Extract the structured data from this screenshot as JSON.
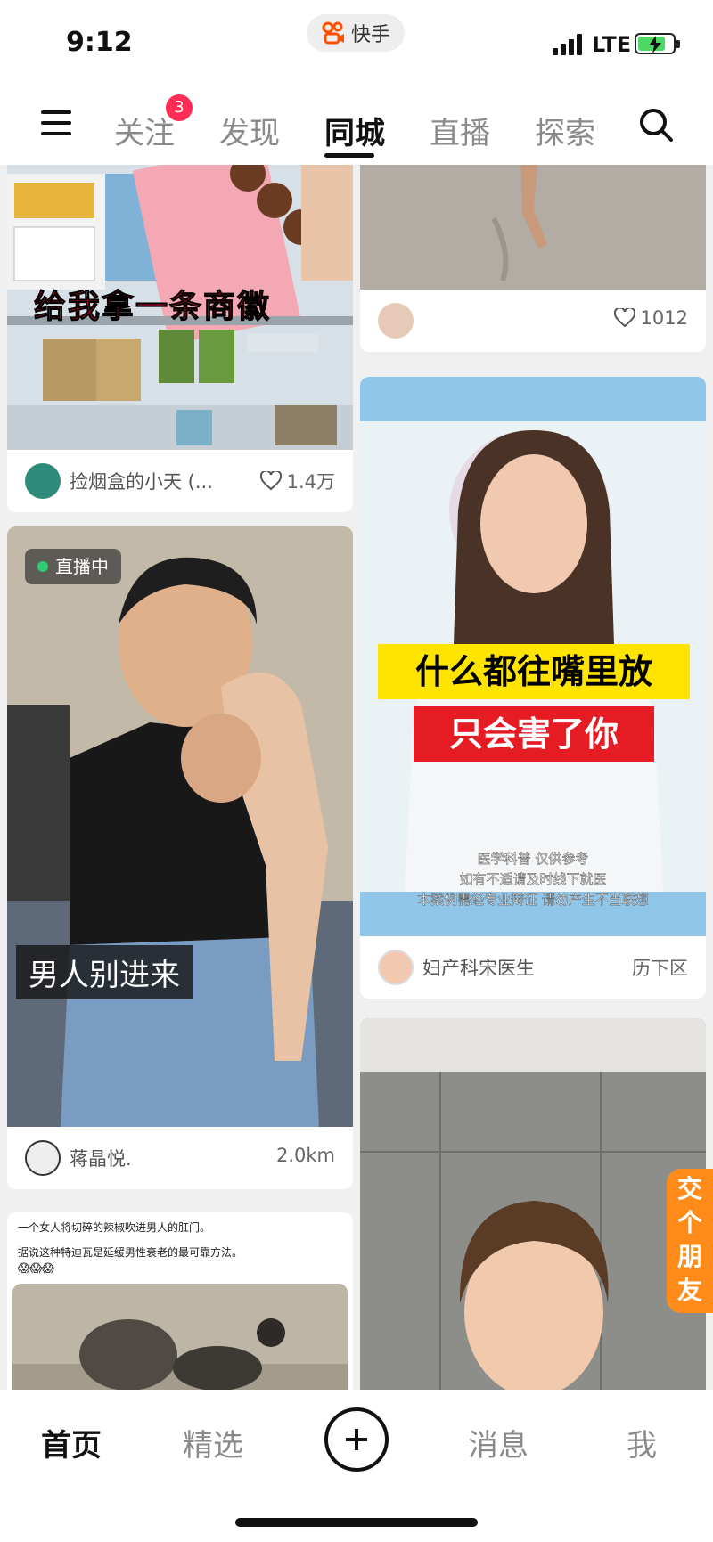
{
  "status_bar": {
    "time": "9:12",
    "app_name": "快手",
    "network": "LTE"
  },
  "top_nav": {
    "tabs": [
      {
        "label": "关注",
        "badge": "3"
      },
      {
        "label": "发现"
      },
      {
        "label": "同城",
        "active": true
      },
      {
        "label": "直播"
      },
      {
        "label": "探索"
      }
    ]
  },
  "feed": {
    "left": [
      {
        "caption": "给我拿一条商徽",
        "author": "捡烟盒的小天 (...",
        "likes": "1.4万"
      },
      {
        "live_label": "直播中",
        "overlay": "男人别进来",
        "author": "蒋晶悦.",
        "distance": "2.0km"
      },
      {
        "text_line1": "一个女人将切碎的辣椒吹进男人的肛门。",
        "text_line2": "据说这种特迪瓦是延缓男性衰老的最可靠方法。",
        "emojis": "😱😱😱"
      }
    ],
    "right": [
      {
        "likes": "1012"
      },
      {
        "headline1": "什么都往嘴里放",
        "headline2": "只会害了你",
        "note1": "医学科普 仅供参考",
        "note2": "如有不适请及时线下就医",
        "note3": "本案例需经专业辩证 请勿产生不当联想",
        "author": "妇产科宋医生",
        "location": "历下区"
      },
      {}
    ],
    "side_tab": "交个朋友"
  },
  "bottom_nav": {
    "tabs": [
      "首页",
      "精选",
      "消息",
      "我"
    ]
  },
  "colors": {
    "badge": "#ff2d55",
    "live_dot": "#2ecc71",
    "side_tab": "#ff8c1a"
  }
}
